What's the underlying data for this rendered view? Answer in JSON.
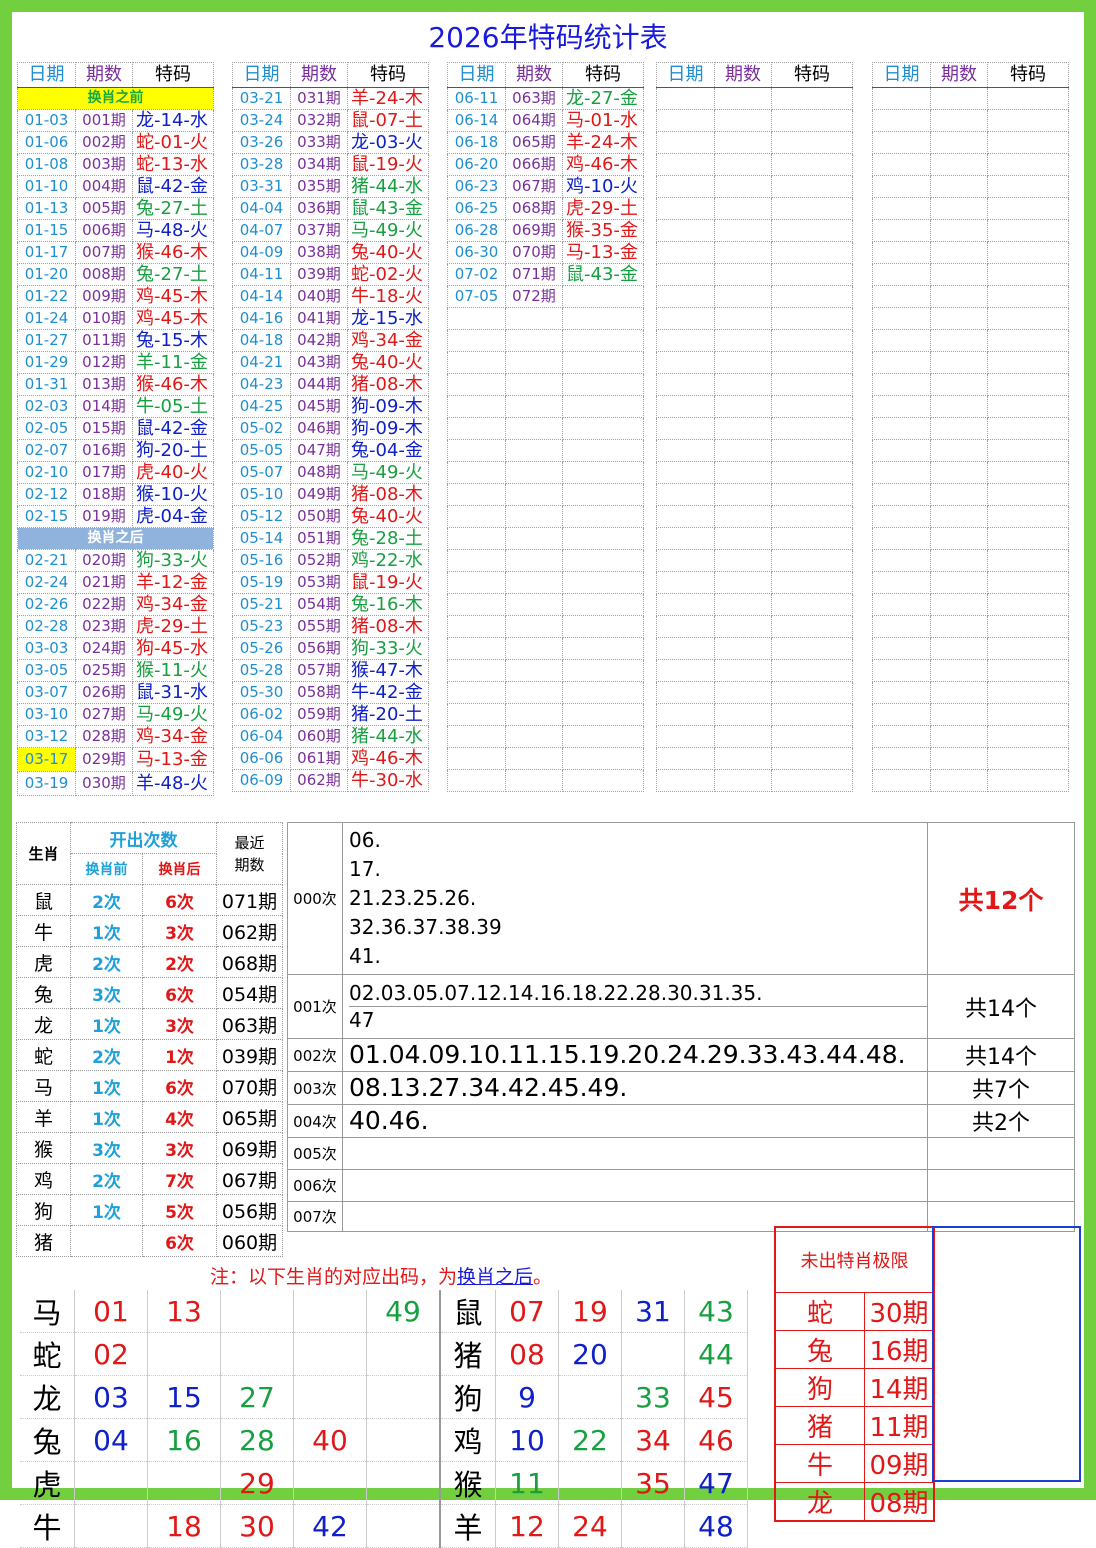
{
  "title": "2026年特码统计表",
  "col_headers": {
    "date": "日期",
    "period": "期数",
    "code": "特码"
  },
  "before_label": "换肖之前",
  "after_label": "换肖之后",
  "rows": [
    [
      "01-03",
      "001期",
      "龙-14-水",
      "water"
    ],
    [
      "01-06",
      "002期",
      "蛇-01-火",
      "fire"
    ],
    [
      "01-08",
      "003期",
      "蛇-13-水",
      "fire"
    ],
    [
      "01-10",
      "004期",
      "鼠-42-金",
      "water"
    ],
    [
      "01-13",
      "005期",
      "兔-27-土",
      "earth"
    ],
    [
      "01-15",
      "006期",
      "马-48-火",
      "water"
    ],
    [
      "01-17",
      "007期",
      "猴-46-木",
      "fire"
    ],
    [
      "01-20",
      "008期",
      "兔-27-土",
      "earth"
    ],
    [
      "01-22",
      "009期",
      "鸡-45-木",
      "fire"
    ],
    [
      "01-24",
      "010期",
      "鸡-45-木",
      "fire"
    ],
    [
      "01-27",
      "011期",
      "兔-15-木",
      "water"
    ],
    [
      "01-29",
      "012期",
      "羊-11-金",
      "earth"
    ],
    [
      "01-31",
      "013期",
      "猴-46-木",
      "fire"
    ],
    [
      "02-03",
      "014期",
      "牛-05-土",
      "earth"
    ],
    [
      "02-05",
      "015期",
      "鼠-42-金",
      "water"
    ],
    [
      "02-07",
      "016期",
      "狗-20-土",
      "water"
    ],
    [
      "02-10",
      "017期",
      "虎-40-火",
      "fire"
    ],
    [
      "02-12",
      "018期",
      "猴-10-火",
      "water"
    ],
    [
      "02-15",
      "019期",
      "虎-04-金",
      "water"
    ],
    [
      "02-21",
      "020期",
      "狗-33-火",
      "earth"
    ],
    [
      "02-24",
      "021期",
      "羊-12-金",
      "fire"
    ],
    [
      "02-26",
      "022期",
      "鸡-34-金",
      "fire"
    ],
    [
      "02-28",
      "023期",
      "虎-29-土",
      "fire"
    ],
    [
      "03-03",
      "024期",
      "狗-45-水",
      "fire"
    ],
    [
      "03-05",
      "025期",
      "猴-11-火",
      "earth"
    ],
    [
      "03-07",
      "026期",
      "鼠-31-水",
      "water"
    ],
    [
      "03-10",
      "027期",
      "马-49-火",
      "earth"
    ],
    [
      "03-12",
      "028期",
      "鸡-34-金",
      "fire"
    ],
    [
      "03-17",
      "029期",
      "马-13-金",
      "fire"
    ],
    [
      "03-19",
      "030期",
      "羊-48-火",
      "water"
    ],
    [
      "03-21",
      "031期",
      "羊-24-木",
      "fire"
    ],
    [
      "03-24",
      "032期",
      "鼠-07-土",
      "fire"
    ],
    [
      "03-26",
      "033期",
      "龙-03-火",
      "water"
    ],
    [
      "03-28",
      "034期",
      "鼠-19-火",
      "fire"
    ],
    [
      "03-31",
      "035期",
      "猪-44-水",
      "earth"
    ],
    [
      "04-04",
      "036期",
      "鼠-43-金",
      "earth"
    ],
    [
      "04-07",
      "037期",
      "马-49-火",
      "earth"
    ],
    [
      "04-09",
      "038期",
      "兔-40-火",
      "fire"
    ],
    [
      "04-11",
      "039期",
      "蛇-02-火",
      "fire"
    ],
    [
      "04-14",
      "040期",
      "牛-18-火",
      "fire"
    ],
    [
      "04-16",
      "041期",
      "龙-15-水",
      "water"
    ],
    [
      "04-18",
      "042期",
      "鸡-34-金",
      "fire"
    ],
    [
      "04-21",
      "043期",
      "兔-40-火",
      "fire"
    ],
    [
      "04-23",
      "044期",
      "猪-08-木",
      "fire"
    ],
    [
      "04-25",
      "045期",
      "狗-09-木",
      "water"
    ],
    [
      "05-02",
      "046期",
      "狗-09-木",
      "water"
    ],
    [
      "05-05",
      "047期",
      "兔-04-金",
      "water"
    ],
    [
      "05-07",
      "048期",
      "马-49-火",
      "earth"
    ],
    [
      "05-10",
      "049期",
      "猪-08-木",
      "fire"
    ],
    [
      "05-12",
      "050期",
      "兔-40-火",
      "fire"
    ],
    [
      "05-14",
      "051期",
      "兔-28-土",
      "earth"
    ],
    [
      "05-16",
      "052期",
      "鸡-22-水",
      "earth"
    ],
    [
      "05-19",
      "053期",
      "鼠-19-火",
      "fire"
    ],
    [
      "05-21",
      "054期",
      "兔-16-木",
      "earth"
    ],
    [
      "05-23",
      "055期",
      "猪-08-木",
      "fire"
    ],
    [
      "05-26",
      "056期",
      "狗-33-火",
      "earth"
    ],
    [
      "05-28",
      "057期",
      "猴-47-木",
      "water"
    ],
    [
      "05-30",
      "058期",
      "牛-42-金",
      "water"
    ],
    [
      "06-02",
      "059期",
      "猪-20-土",
      "water"
    ],
    [
      "06-04",
      "060期",
      "猪-44-水",
      "earth"
    ],
    [
      "06-06",
      "061期",
      "鸡-46-木",
      "fire"
    ],
    [
      "06-09",
      "062期",
      "牛-30-水",
      "fire"
    ],
    [
      "06-11",
      "063期",
      "龙-27-金",
      "earth"
    ],
    [
      "06-14",
      "064期",
      "马-01-水",
      "fire"
    ],
    [
      "06-18",
      "065期",
      "羊-24-木",
      "fire"
    ],
    [
      "06-20",
      "066期",
      "鸡-46-木",
      "fire"
    ],
    [
      "06-23",
      "067期",
      "鸡-10-火",
      "water"
    ],
    [
      "06-25",
      "068期",
      "虎-29-土",
      "fire"
    ],
    [
      "06-28",
      "069期",
      "猴-35-金",
      "fire"
    ],
    [
      "06-30",
      "070期",
      "马-13-金",
      "fire"
    ],
    [
      "07-02",
      "071期",
      "鼠-43-金",
      "earth"
    ],
    [
      "07-05",
      "072期",
      "",
      ""
    ]
  ],
  "stats": {
    "h_zodiac": "生肖",
    "h_count": "开出次数",
    "h_before": "换肖前",
    "h_after": "换肖后",
    "h_recent": "最近\n期数",
    "rows": [
      [
        "鼠",
        "2次",
        "6次",
        "071期"
      ],
      [
        "牛",
        "1次",
        "3次",
        "062期"
      ],
      [
        "虎",
        "2次",
        "2次",
        "068期"
      ],
      [
        "兔",
        "3次",
        "6次",
        "054期"
      ],
      [
        "龙",
        "1次",
        "3次",
        "063期"
      ],
      [
        "蛇",
        "2次",
        "1次",
        "039期"
      ],
      [
        "马",
        "1次",
        "6次",
        "070期"
      ],
      [
        "羊",
        "1次",
        "4次",
        "065期"
      ],
      [
        "猴",
        "3次",
        "3次",
        "069期"
      ],
      [
        "鸡",
        "2次",
        "7次",
        "067期"
      ],
      [
        "狗",
        "1次",
        "5次",
        "056期"
      ],
      [
        "猪",
        "",
        "6次",
        "060期"
      ]
    ]
  },
  "freq": [
    {
      "label": "000次",
      "lines": [
        "06.",
        "17.",
        "21.23.25.26.",
        "32.36.37.38.39",
        "41."
      ],
      "count": "共12个"
    },
    {
      "label": "001次",
      "lines": [
        "02.03.05.07.12.14.16.18.22.28.30.31.35.",
        "47"
      ],
      "count": "共14个"
    },
    {
      "label": "002次",
      "lines": [
        "01.04.09.10.11.15.19.20.24.29.33.43.44.48."
      ],
      "count": "共14个"
    },
    {
      "label": "003次",
      "lines": [
        "08.13.27.34.42.45.49."
      ],
      "count": "共7个"
    },
    {
      "label": "004次",
      "lines": [
        "40.46."
      ],
      "count": "共2个"
    },
    {
      "label": "005次",
      "lines": [
        ""
      ],
      "count": ""
    },
    {
      "label": "006次",
      "lines": [
        ""
      ],
      "count": ""
    },
    {
      "label": "007次",
      "lines": [
        ""
      ],
      "count": ""
    }
  ],
  "note": {
    "prefix": "注：以下生肖的对应出码，为",
    "link": "换肖之后",
    "suffix": "。"
  },
  "zodiac_codes": [
    {
      "z": "马",
      "n": [
        [
          "01",
          "rd"
        ],
        [
          "13",
          "rd"
        ],
        [
          "",
          ""
        ],
        [
          "",
          ""
        ],
        [
          "49",
          "gr"
        ]
      ]
    },
    {
      "z": "蛇",
      "n": [
        [
          "02",
          "rd"
        ],
        [
          "",
          ""
        ],
        [
          "",
          ""
        ],
        [
          "",
          ""
        ],
        [
          "",
          ""
        ]
      ]
    },
    {
      "z": "龙",
      "n": [
        [
          "03",
          "bl"
        ],
        [
          "15",
          "bl"
        ],
        [
          "27",
          "gr"
        ],
        [
          "",
          ""
        ],
        [
          "",
          ""
        ]
      ]
    },
    {
      "z": "兔",
      "n": [
        [
          "04",
          "bl"
        ],
        [
          "16",
          "gr"
        ],
        [
          "28",
          "gr"
        ],
        [
          "40",
          "rd"
        ],
        [
          "",
          ""
        ]
      ]
    },
    {
      "z": "虎",
      "n": [
        [
          "",
          ""
        ],
        [
          "",
          ""
        ],
        [
          "29",
          "rd"
        ],
        [
          "",
          ""
        ],
        [
          "",
          ""
        ]
      ]
    },
    {
      "z": "牛",
      "n": [
        [
          "",
          ""
        ],
        [
          "18",
          "rd"
        ],
        [
          "30",
          "rd"
        ],
        [
          "42",
          "bl"
        ],
        [
          "",
          ""
        ]
      ]
    }
  ],
  "zodiac_codes_r": [
    {
      "z": "鼠",
      "n": [
        [
          "07",
          "rd"
        ],
        [
          "19",
          "rd"
        ],
        [
          "31",
          "bl"
        ],
        [
          "43",
          "gr"
        ]
      ]
    },
    {
      "z": "猪",
      "n": [
        [
          "08",
          "rd"
        ],
        [
          "20",
          "bl"
        ],
        [
          "",
          ""
        ],
        [
          "44",
          "gr"
        ]
      ]
    },
    {
      "z": "狗",
      "n": [
        [
          "9",
          "bl"
        ],
        [
          "",
          ""
        ],
        [
          "33",
          "gr"
        ],
        [
          "45",
          "rd"
        ]
      ]
    },
    {
      "z": "鸡",
      "n": [
        [
          "10",
          "bl"
        ],
        [
          "22",
          "gr"
        ],
        [
          "34",
          "rd"
        ],
        [
          "46",
          "rd"
        ]
      ]
    },
    {
      "z": "猴",
      "n": [
        [
          "11",
          "gr"
        ],
        [
          "",
          ""
        ],
        [
          "35",
          "rd"
        ],
        [
          "47",
          "bl"
        ]
      ]
    },
    {
      "z": "羊",
      "n": [
        [
          "12",
          "rd"
        ],
        [
          "24",
          "rd"
        ],
        [
          "",
          ""
        ],
        [
          "48",
          "bl"
        ]
      ]
    }
  ],
  "limit": {
    "header": "未出特肖极限",
    "rows": [
      [
        "蛇",
        "30期"
      ],
      [
        "兔",
        "16期"
      ],
      [
        "狗",
        "14期"
      ],
      [
        "猪",
        "11期"
      ],
      [
        "牛",
        "09期"
      ],
      [
        "龙",
        "08期"
      ]
    ]
  }
}
